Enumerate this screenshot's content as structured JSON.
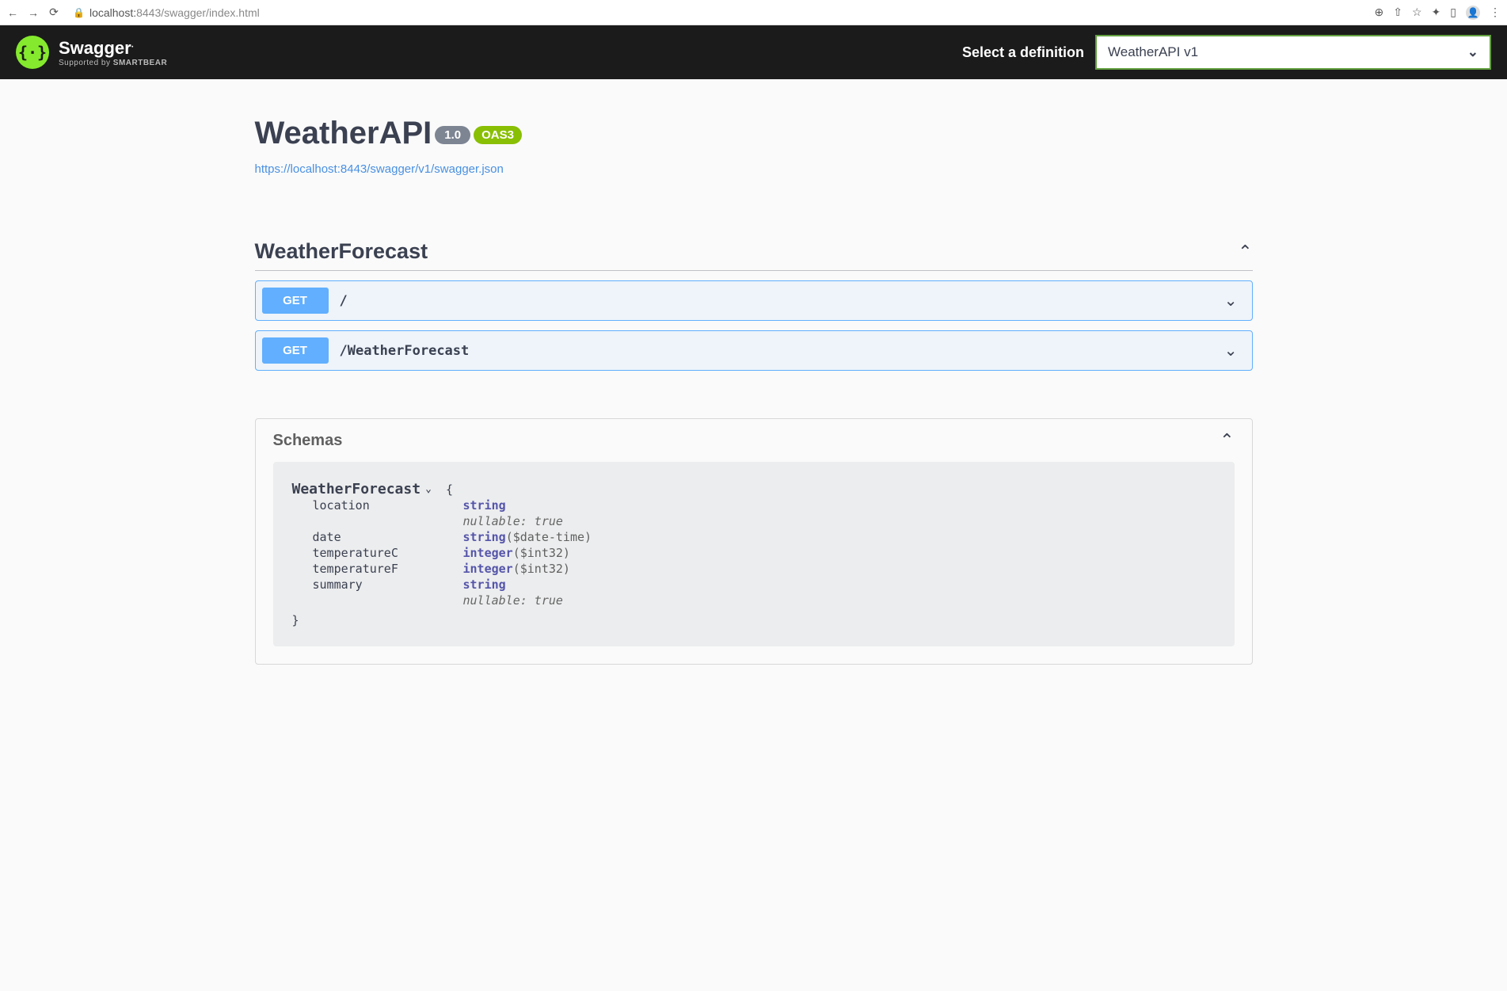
{
  "browser": {
    "url_prefix": "localhost:",
    "url_port_path": "8443/swagger/index.html"
  },
  "topbar": {
    "brand_glyph": "{⋅}",
    "brand_name": "Swagger",
    "brand_sub_prefix": "Supported by",
    "brand_sub_bold": "SMARTBEAR",
    "select_label": "Select a definition",
    "selected_definition": "WeatherAPI v1"
  },
  "info": {
    "title": "WeatherAPI",
    "version": "1.0",
    "oas_badge": "OAS3",
    "spec_url": "https://localhost:8443/swagger/v1/swagger.json"
  },
  "tag": {
    "name": "WeatherForecast",
    "operations": [
      {
        "method": "GET",
        "path": "/"
      },
      {
        "method": "GET",
        "path": "/WeatherForecast"
      }
    ]
  },
  "schemas": {
    "section_title": "Schemas",
    "model_name": "WeatherForecast",
    "properties": [
      {
        "name": "location",
        "type": "string",
        "format": "",
        "meta": "nullable: true"
      },
      {
        "name": "date",
        "type": "string",
        "format": "($date-time)",
        "meta": ""
      },
      {
        "name": "temperatureC",
        "type": "integer",
        "format": "($int32)",
        "meta": ""
      },
      {
        "name": "temperatureF",
        "type": "integer",
        "format": "($int32)",
        "meta": ""
      },
      {
        "name": "summary",
        "type": "string",
        "format": "",
        "meta": "nullable: true"
      }
    ]
  }
}
